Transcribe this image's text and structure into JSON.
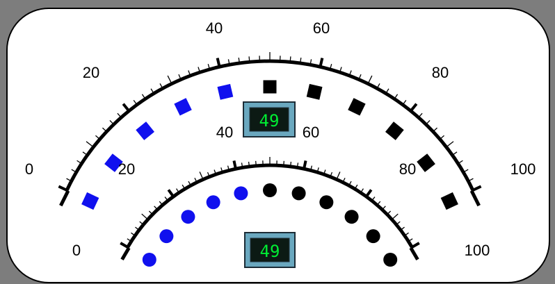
{
  "colors": {
    "frame": "#7d7d7d",
    "panel": "#ffffff",
    "lit": "#1010ee",
    "unlit": "#000000",
    "digit": "#00ee33",
    "display_bg": "#0c1a14",
    "display_rim": "#6aa8bf"
  },
  "gauges": [
    {
      "name": "outer",
      "shape": "square",
      "min": 0,
      "max": 100,
      "value": 49,
      "readout": "49",
      "tick_labels": [
        "0",
        "20",
        "40",
        "60",
        "80",
        "100"
      ],
      "indicator_count": 11
    },
    {
      "name": "inner",
      "shape": "circle",
      "min": 0,
      "max": 100,
      "value": 49,
      "readout": "49",
      "tick_labels": [
        "0",
        "20",
        "40",
        "60",
        "80",
        "100"
      ],
      "indicator_count": 11
    }
  ]
}
